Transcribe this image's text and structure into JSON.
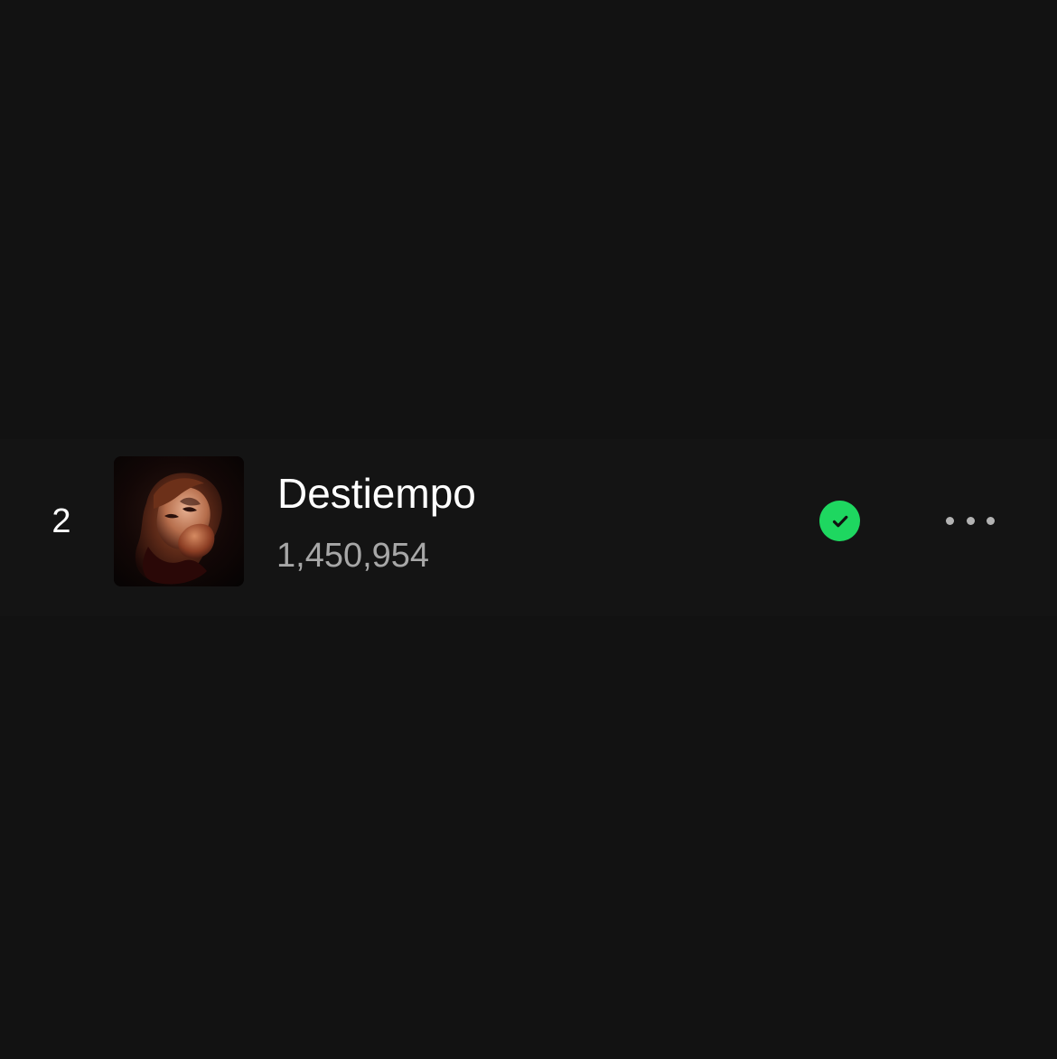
{
  "track": {
    "rank": "2",
    "title": "Destiempo",
    "plays": "1,450,954",
    "saved": true,
    "cover_alt": "Destiempo cover art"
  },
  "icons": {
    "saved": "check-circle-icon",
    "more": "more-options-icon"
  },
  "colors": {
    "background": "#121212",
    "row_background": "#141414",
    "primary_text": "#ffffff",
    "secondary_text": "#a7a7a7",
    "accent": "#1ed760",
    "more_dots": "#b3b3b3"
  }
}
